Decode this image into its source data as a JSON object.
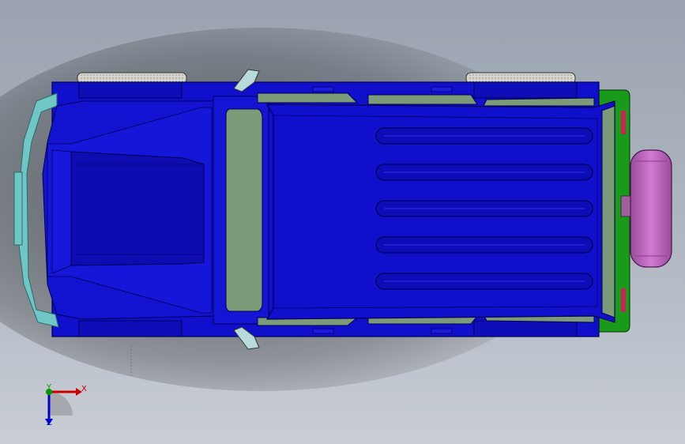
{
  "colors": {
    "body": "#1010cc",
    "body_dark": "#0a0a9e",
    "edge": "#000055",
    "glass": "#7a9a78",
    "bumper": "#6fc6c4",
    "spare_wheel": "#c26ac2",
    "rear_trim": "#1a9a1a",
    "tire": "#d0d0c8",
    "axis_x": "#cc0000",
    "axis_y": "#009900",
    "axis_z": "#0000cc"
  },
  "triad": {
    "x_label": "X",
    "y_label": "Y",
    "z_label": "Z"
  },
  "icons": {
    "triad": "coordinate-triad-icon"
  }
}
